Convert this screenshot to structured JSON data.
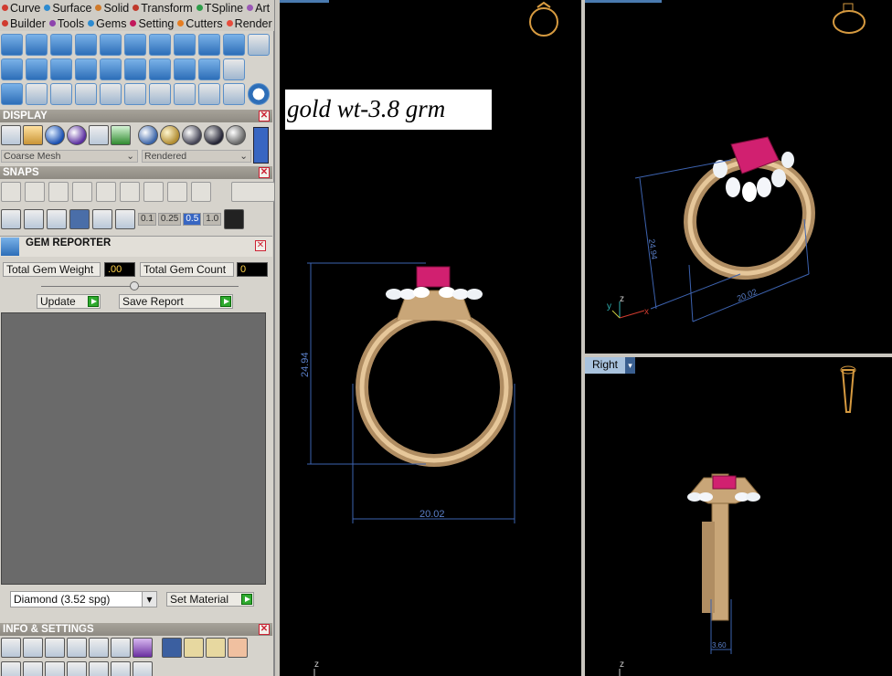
{
  "menus_row1": [
    {
      "label": "Curve",
      "color": "#d03b2f"
    },
    {
      "label": "Surface",
      "color": "#2d8bd0"
    },
    {
      "label": "Solid",
      "color": "#d07a2a"
    },
    {
      "label": "Transform",
      "color": "#c0392b"
    },
    {
      "label": "TSpline",
      "color": "#2e9d4a"
    },
    {
      "label": "Art",
      "color": "#9b59b6"
    }
  ],
  "menus_row2": [
    {
      "label": "Builder",
      "color": "#d03b2f"
    },
    {
      "label": "Tools",
      "color": "#8e44ad"
    },
    {
      "label": "Gems",
      "color": "#2d8bd0"
    },
    {
      "label": "Setting",
      "color": "#c2185b"
    },
    {
      "label": "Cutters",
      "color": "#e67e22"
    },
    {
      "label": "Render",
      "color": "#e74c3c"
    }
  ],
  "display": {
    "title": "DISPLAY",
    "mesh_select": "Coarse Mesh",
    "render_select": "Rendered"
  },
  "snaps": {
    "title": "SNAPS",
    "values": [
      "0.1",
      "0.25",
      "0.5",
      "1.0"
    ],
    "selected": "0.5"
  },
  "gem_reporter": {
    "title": "GEM REPORTER",
    "total_weight_label": "Total Gem Weight",
    "total_weight": ".00",
    "total_count_label": "Total Gem Count",
    "total_count": "0",
    "update_label": "Update",
    "save_label": "Save Report",
    "gem_select": "Diamond    (3.52 spg)",
    "set_material_label": "Set Material"
  },
  "info": {
    "title": "INFO & SETTINGS"
  },
  "annotation": {
    "text": "gold  wt-3.8  grm"
  },
  "front_view": {
    "height_dim": "24.94",
    "width_dim": "20.02",
    "axis_label": "z"
  },
  "persp_view": {
    "height_dim": "24.94",
    "width_dim": "20.02",
    "axis_z": "z",
    "axis_x": "x",
    "axis_y": "y"
  },
  "right_view": {
    "tab_label": "Right",
    "width_dim": "3.60",
    "axis_label": "z"
  },
  "colors": {
    "gold": "#d9b98a",
    "ruby": "#c81a63",
    "dim": "#3d63b0"
  }
}
